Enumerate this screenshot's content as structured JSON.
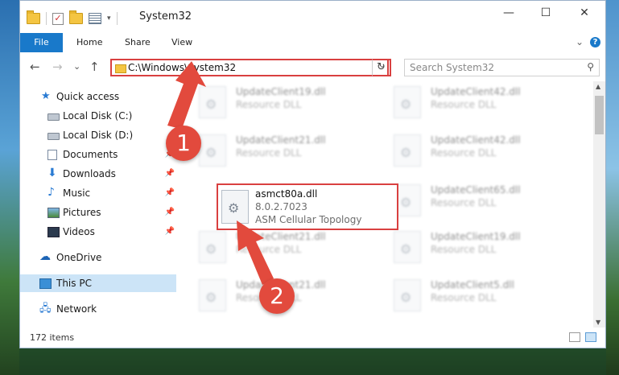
{
  "window": {
    "title": "System32",
    "controls": {
      "minimize": "—",
      "maximize": "☐",
      "close": "✕"
    }
  },
  "ribbon": {
    "tabs": [
      "File",
      "Home",
      "Share",
      "View"
    ],
    "collapse_glyph": "⌄",
    "help_glyph": "?"
  },
  "toolbar": {
    "back_glyph": "←",
    "forward_glyph": "→",
    "recent_glyph": "⌄",
    "up_glyph": "↑",
    "address": "C:\\Windows\\System32",
    "address_dropdown_glyph": "⌄",
    "refresh_glyph": "↻",
    "search_placeholder": "Search System32",
    "search_glyph": "⚲"
  },
  "navpane": {
    "items": [
      {
        "label": "Quick access",
        "icon": "star-icon",
        "pinned": false
      },
      {
        "label": "Local Disk (C:)",
        "icon": "drive-icon",
        "pinned": false
      },
      {
        "label": "Local Disk (D:)",
        "icon": "drive-icon",
        "pinned": false
      },
      {
        "label": "Documents",
        "icon": "documents-icon",
        "pinned": true
      },
      {
        "label": "Downloads",
        "icon": "downloads-icon",
        "pinned": true
      },
      {
        "label": "Music",
        "icon": "music-icon",
        "pinned": true
      },
      {
        "label": "Pictures",
        "icon": "pictures-icon",
        "pinned": true
      },
      {
        "label": "Videos",
        "icon": "videos-icon",
        "pinned": true
      },
      {
        "label": "OneDrive",
        "icon": "onedrive-icon",
        "pinned": false
      },
      {
        "label": "This PC",
        "icon": "this-pc-icon",
        "pinned": false,
        "selected": true
      },
      {
        "label": "Network",
        "icon": "network-icon",
        "pinned": false
      }
    ],
    "pin_glyph": "📌"
  },
  "files": {
    "left_column": [
      {
        "name": "UpdateClient19.dll",
        "type": "Resource DLL"
      },
      {
        "name": "UpdateClient21.dll",
        "type": "Resource DLL"
      },
      {
        "name": "UpdateClient21.dll",
        "type": "Resource DLL"
      },
      {
        "name": "UpdateClient21.dll",
        "type": "Resource DLL"
      }
    ],
    "right_column": [
      {
        "name": "UpdateClient42.dll",
        "type": "Resource DLL"
      },
      {
        "name": "UpdateClient42.dll",
        "type": "Resource DLL"
      },
      {
        "name": "UpdateClient65.dll",
        "type": "Resource DLL"
      },
      {
        "name": "UpdateClient19.dll",
        "type": "Resource DLL"
      },
      {
        "name": "UpdateClient5.dll",
        "type": "Resource DLL"
      }
    ],
    "highlighted": {
      "name": "asmct80a.dll",
      "version": "8.0.2.7023",
      "description": "ASM Cellular Topology"
    }
  },
  "status": {
    "item_count": "172 items"
  },
  "callouts": {
    "one": "1",
    "two": "2"
  },
  "colors": {
    "accent": "#1979ca",
    "highlight_red": "#d94040",
    "callout_red": "#e24a3d",
    "selected_bg": "#cce4f7"
  }
}
